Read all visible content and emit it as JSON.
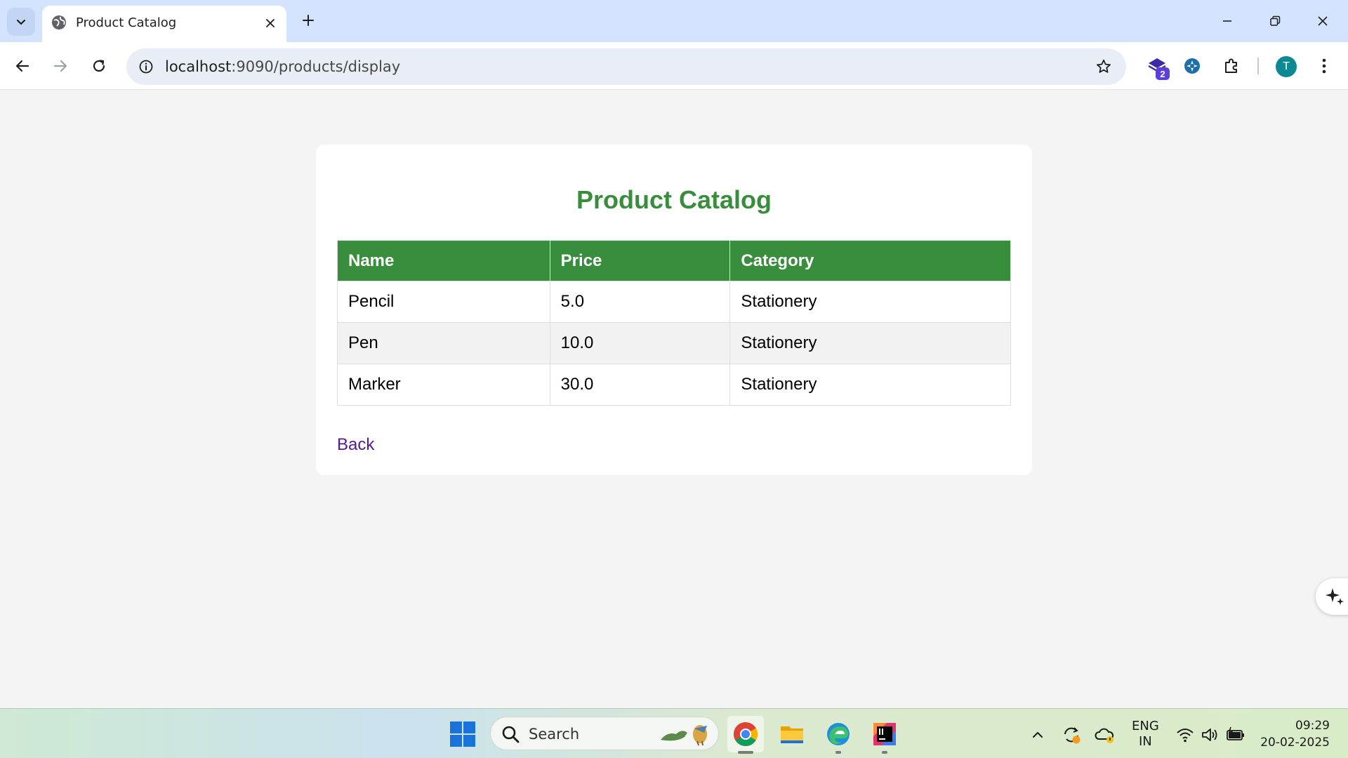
{
  "browser": {
    "tab": {
      "title": "Product Catalog",
      "favicon": "globe-icon"
    },
    "url": {
      "host": "localhost",
      "rest": ":9090/products/display"
    },
    "extension_badge": "2",
    "profile_initial": "T"
  },
  "page": {
    "title": "Product Catalog",
    "table": {
      "headers": [
        "Name",
        "Price",
        "Category"
      ],
      "rows": [
        [
          "Pencil",
          "5.0",
          "Stationery"
        ],
        [
          "Pen",
          "10.0",
          "Stationery"
        ],
        [
          "Marker",
          "30.0",
          "Stationery"
        ]
      ]
    },
    "back_link": "Back"
  },
  "colors": {
    "accent_green": "#388e3c",
    "link_visited": "#551a8b",
    "tabbar": "#d3e3fd"
  },
  "taskbar": {
    "search_placeholder": "Search",
    "language": {
      "line1": "ENG",
      "line2": "IN"
    },
    "clock": {
      "time": "09:29",
      "date": "20-02-2025"
    }
  }
}
